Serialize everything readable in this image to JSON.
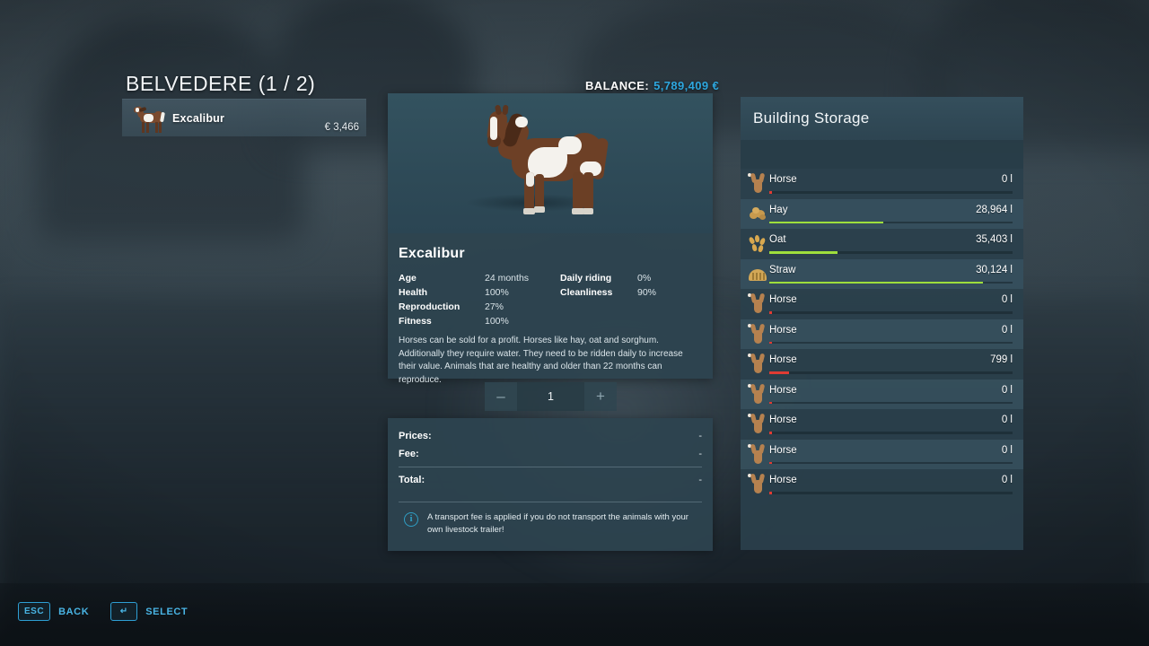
{
  "header": {
    "shop_title": "BELVEDERE (1 / 2)",
    "balance_label": "BALANCE:",
    "balance_value": "5,789,409 €",
    "balance_color": "#2ea8e0"
  },
  "animal_list": [
    {
      "name": "Excalibur",
      "price": "€ 3,466",
      "icon": "horse-icon"
    }
  ],
  "detail": {
    "name": "Excalibur",
    "stats": [
      {
        "key": "Age",
        "value": "24 months",
        "key2": "Daily riding",
        "value2": "0%"
      },
      {
        "key": "Health",
        "value": "100%",
        "key2": "Cleanliness",
        "value2": "90%"
      },
      {
        "key": "Reproduction",
        "value": "27%",
        "key2": "",
        "value2": ""
      },
      {
        "key": "Fitness",
        "value": "100%",
        "key2": "",
        "value2": ""
      }
    ],
    "description": "Horses can be sold for a profit. Horses like hay, oat and sorghum. Additionally they require water. They need to be ridden daily to increase their value. Animals that are healthy and older than 22 months can reproduce."
  },
  "stepper": {
    "decrease_label": "–",
    "increase_label": "+",
    "quantity": "1"
  },
  "prices": {
    "rows": [
      {
        "label": "Prices:",
        "value": "-"
      },
      {
        "label": "Fee:",
        "value": "-"
      },
      {
        "label": "Total:",
        "value": "-"
      }
    ],
    "note": "A transport fee is applied if you do not transport the animals with your own livestock trailer!",
    "note_icon": "info-icon"
  },
  "storage": {
    "title": "Building Storage",
    "rows": [
      {
        "name": "Horse",
        "amount": "0 l",
        "fill_pct": 1,
        "fill_color": "#e03b33",
        "icon": "horse-icon"
      },
      {
        "name": "Hay",
        "amount": "28,964 l",
        "fill_pct": 47,
        "fill_color": "#9ede3c",
        "icon": "hay-icon"
      },
      {
        "name": "Oat",
        "amount": "35,403 l",
        "fill_pct": 28,
        "fill_color": "#9ede3c",
        "icon": "oat-icon"
      },
      {
        "name": "Straw",
        "amount": "30,124 l",
        "fill_pct": 88,
        "fill_color": "#9ede3c",
        "icon": "straw-icon"
      },
      {
        "name": "Horse",
        "amount": "0 l",
        "fill_pct": 1,
        "fill_color": "#e03b33",
        "icon": "horse-icon"
      },
      {
        "name": "Horse",
        "amount": "0 l",
        "fill_pct": 1,
        "fill_color": "#e03b33",
        "icon": "horse-icon"
      },
      {
        "name": "Horse",
        "amount": "799 l",
        "fill_pct": 8,
        "fill_color": "#e03b33",
        "icon": "horse-icon"
      },
      {
        "name": "Horse",
        "amount": "0 l",
        "fill_pct": 1,
        "fill_color": "#e03b33",
        "icon": "horse-icon"
      },
      {
        "name": "Horse",
        "amount": "0 l",
        "fill_pct": 1,
        "fill_color": "#e03b33",
        "icon": "horse-icon"
      },
      {
        "name": "Horse",
        "amount": "0 l",
        "fill_pct": 1,
        "fill_color": "#e03b33",
        "icon": "horse-icon"
      },
      {
        "name": "Horse",
        "amount": "0 l",
        "fill_pct": 1,
        "fill_color": "#e03b33",
        "icon": "horse-icon"
      }
    ]
  },
  "bottom_bar": [
    {
      "key": "ESC",
      "label": "BACK",
      "icon": "esc-key"
    },
    {
      "key": "↵",
      "label": "SELECT",
      "icon": "enter-key"
    }
  ]
}
